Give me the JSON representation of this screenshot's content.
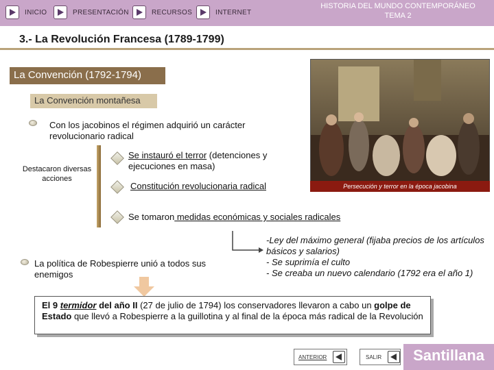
{
  "nav": {
    "inicio": "INICIO",
    "presentacion": "PRESENTACIÓN",
    "recursos": "RECURSOS",
    "internet": "INTERNET"
  },
  "course": {
    "line1": "HISTORIA DEL MUNDO CONTEMPORÁNEO",
    "line2": "TEMA 2"
  },
  "section_title": "3.- La Revolución Francesa (1789-1799)",
  "subtitle": "La Convención (1792-1794)",
  "subsubtitle": "La Convención montañesa",
  "content": {
    "p1": "Con los jacobinos el régimen adquirió un carácter revolucionario radical",
    "destacaron": "Destacaron diversas acciones",
    "item1_underlined": "Se instauró el terror",
    "item1_rest": " (detenciones y ejecuciones en masa)",
    "item2": "Constitución revolucionaria radical",
    "item3_pre": "Se tomaron",
    "item3_underlined": " medidas económicas y sociales radicales",
    "measures": [
      "-Ley del máximo general (fijaba precios de los artículos básicos y salarios)",
      "- Se suprimía el culto",
      "- Se creaba un nuevo calendario (1792 era el año 1)"
    ],
    "robespierre": "La política de Robespierre unió a todos sus enemigos"
  },
  "image_caption": "Persecución y terror en la época jacobina",
  "box": {
    "el9": "El 9 ",
    "termidor": "termidor",
    "del_ano": " del año II",
    "rest1": " (27 de julio de 1794) los conservadores llevaron a cabo un ",
    "golpe": "golpe de Estado",
    "rest2": " que llevó a  Robespierre a la guillotina y al final de la época más radical de la Revolución"
  },
  "footer": {
    "anterior": "ANTERIOR",
    "salir": "SALIR",
    "brand": "Santillana"
  },
  "colors": {
    "topbar": "#c9a6c9",
    "subbar": "#8a6e4b",
    "caption": "#8b1a10"
  }
}
